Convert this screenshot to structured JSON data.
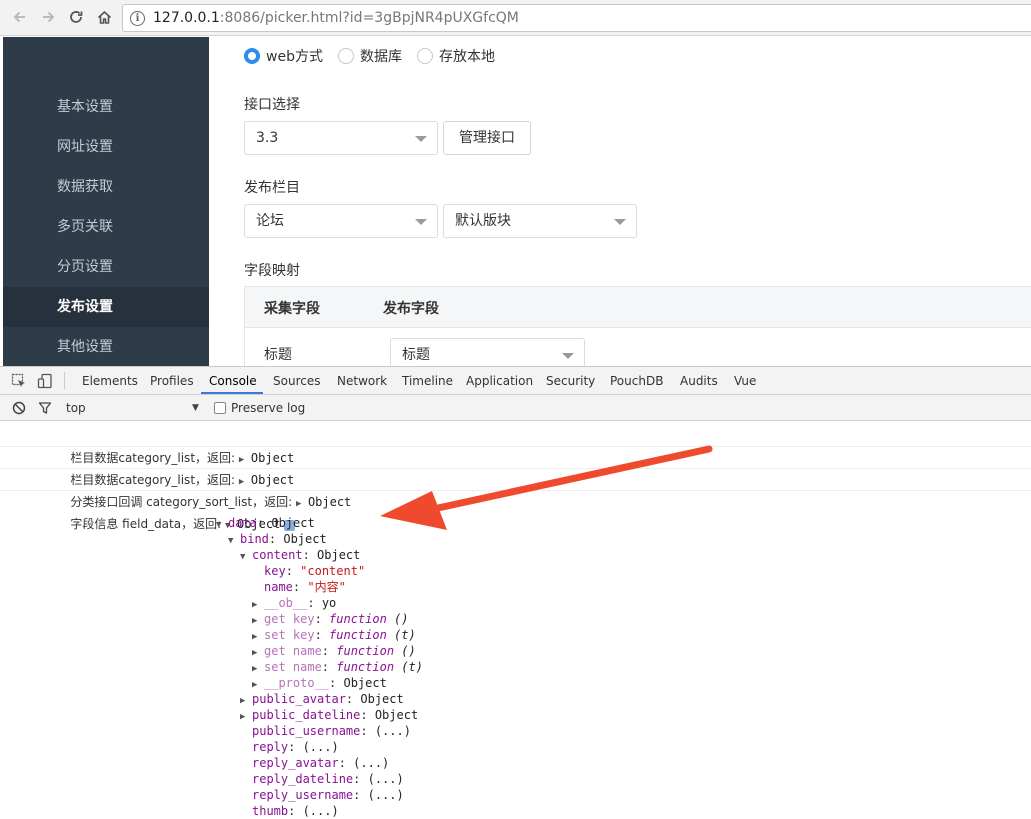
{
  "browser": {
    "url_host": "127.0.0.1",
    "url_rest": ":8086/picker.html?id=3gBpjNR4pUXGfcQM"
  },
  "sidebar": {
    "items": [
      {
        "label": "基本设置"
      },
      {
        "label": "网址设置"
      },
      {
        "label": "数据获取"
      },
      {
        "label": "多页关联"
      },
      {
        "label": "分页设置"
      },
      {
        "label": "发布设置",
        "active": true
      },
      {
        "label": "其他设置"
      }
    ]
  },
  "form": {
    "publish_methods": [
      {
        "label": "web方式",
        "checked": true
      },
      {
        "label": "数据库",
        "checked": false
      },
      {
        "label": "存放本地",
        "checked": false
      }
    ],
    "interface": {
      "label": "接口选择",
      "value": "3.3",
      "manage_button": "管理接口"
    },
    "column": {
      "label": "发布栏目",
      "forum": "论坛",
      "block": "默认版块"
    },
    "mapping": {
      "label": "字段映射",
      "col_collect": "采集字段",
      "col_publish": "发布字段",
      "row_field": "标题",
      "row_value": "标题"
    }
  },
  "devtools": {
    "tabs": [
      "Elements",
      "Profiles",
      "Console",
      "Sources",
      "Network",
      "Timeline",
      "Application",
      "Security",
      "PouchDB",
      "Audits",
      "Vue"
    ],
    "active_tab": "Console",
    "context": "top",
    "preserve_log": "Preserve log",
    "logs": [
      {
        "msg": "栏目数据category_list，返回: ",
        "value": "Object"
      },
      {
        "msg": "栏目数据category_list，返回: ",
        "value": "Object"
      },
      {
        "msg": "分类接口回调 category_sort_list，返回: ",
        "value": "Object"
      }
    ],
    "field_log": {
      "msg": "字段信息 field_data，返回: ",
      "value": "Object",
      "badge": "i"
    },
    "tree": [
      {
        "key": "data",
        "value": "Object"
      },
      {
        "key": "bind",
        "value": "Object"
      },
      {
        "key": "content",
        "value": "Object"
      },
      {
        "key": "key",
        "value": "\"content\""
      },
      {
        "key": "name",
        "value": "\"内容\""
      },
      {
        "key": "__ob__",
        "value": "yo"
      },
      {
        "key": "get key",
        "value": "function",
        "args": " ()"
      },
      {
        "key": "set key",
        "value": "function",
        "args": " (t)"
      },
      {
        "key": "get name",
        "value": "function",
        "args": " ()"
      },
      {
        "key": "set name",
        "value": "function",
        "args": " (t)"
      },
      {
        "key": "__proto__",
        "value": "Object"
      },
      {
        "key": "public_avatar",
        "value": "Object"
      },
      {
        "key": "public_dateline",
        "value": "Object"
      },
      {
        "key": "public_username",
        "value": "(...)"
      },
      {
        "key": "reply",
        "value": "(...)"
      },
      {
        "key": "reply_avatar",
        "value": "(...)"
      },
      {
        "key": "reply_dateline",
        "value": "(...)"
      },
      {
        "key": "reply_username",
        "value": "(...)"
      },
      {
        "key": "thumb",
        "value": "(...)"
      }
    ]
  },
  "colors": {
    "sidebar_bg": "#2e3b49",
    "accent": "#2d8cf0",
    "arrow": "#f04a2e"
  }
}
